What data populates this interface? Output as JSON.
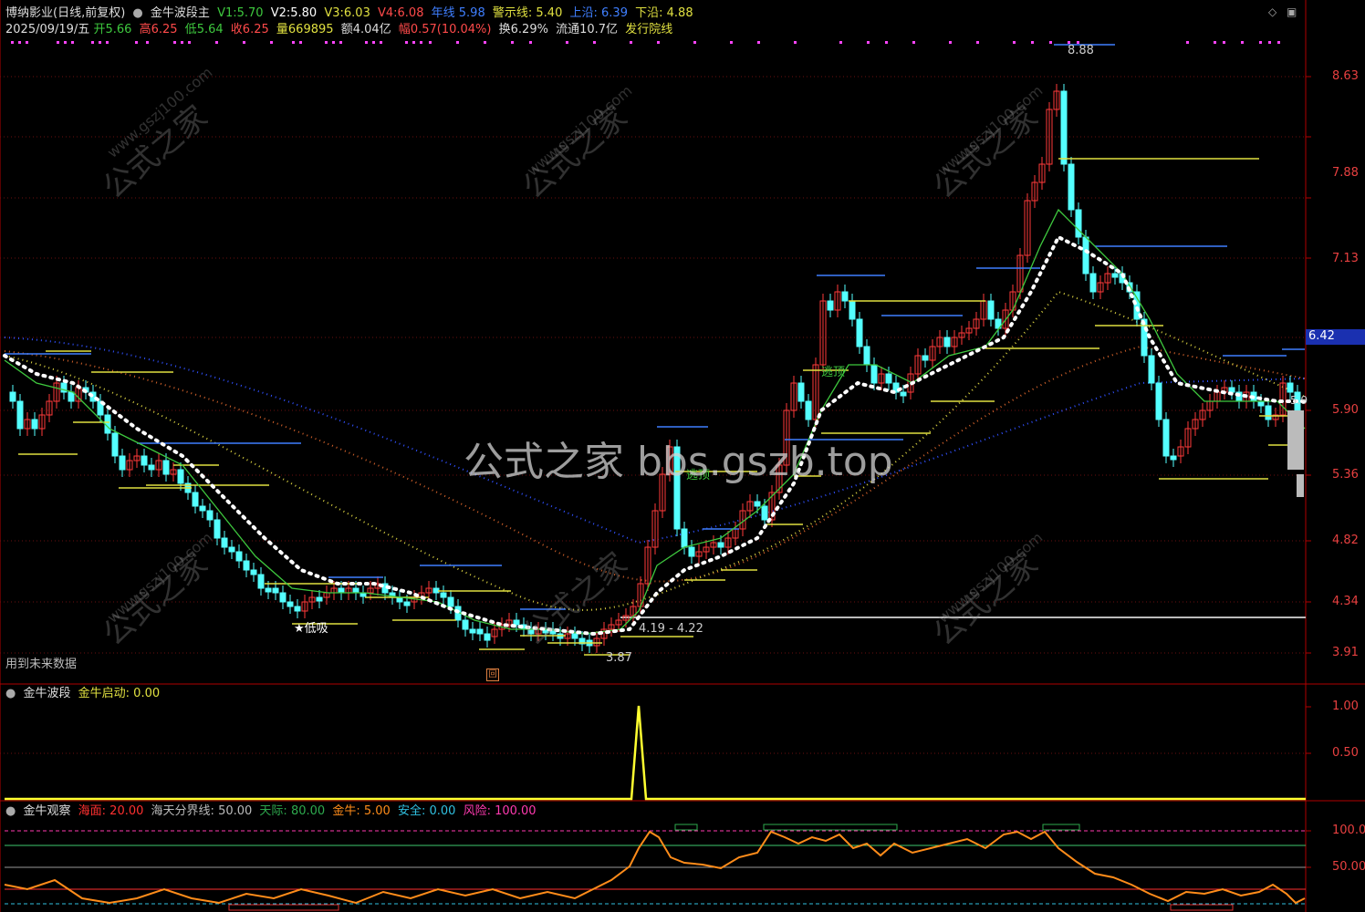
{
  "header": {
    "stock": "博纳影业(日线,前复权)",
    "indicator": "金牛波段主",
    "v1_label": "V1:",
    "v1": "5.70",
    "v2_label": "V2:",
    "v2": "5.80",
    "v3_label": "V3:",
    "v3": "6.03",
    "v4_label": "V4:",
    "v4": "6.08",
    "nianxian_label": "年线",
    "nianxian": "5.98",
    "jingshi_label": "警示线:",
    "jingshi": "5.40",
    "shangyan_label": "上沿:",
    "shangyan": "6.39",
    "xiayan_label": "下沿:",
    "xiayan": "4.88"
  },
  "quote": {
    "date": "2025/09/19/五",
    "open_label": "开",
    "open": "5.66",
    "high_label": "高",
    "high": "6.25",
    "low_label": "低",
    "low": "5.64",
    "close_label": "收",
    "close": "6.25",
    "vol_label": "量",
    "vol": "669895",
    "amt_label": "额",
    "amt": "4.04亿",
    "chg_label": "幅",
    "chg": "0.57(10.04%)",
    "turn_label": "换",
    "turn": "6.29%",
    "float_label": "流通",
    "float": "10.7亿",
    "issue": "发行院线"
  },
  "main_axis": [
    "8.63",
    "7.88",
    "7.13",
    "6.42",
    "5.90",
    "5.36",
    "4.82",
    "4.34",
    "3.91"
  ],
  "current_price_tag": "6.42",
  "annotations": {
    "peak": "8.88",
    "low": "3.87",
    "range": "4.19 - 4.22",
    "dixi": "★低吸",
    "taoding1": "逃顶",
    "taoding2": "逃顶",
    "right_small": "5.9",
    "future_note": "用到未来数据"
  },
  "watermark": {
    "center": "公式之家 bbs.gszb.top",
    "diag1": "公式之家",
    "diag2": "www.gszj100.com"
  },
  "panel2": {
    "title": "金牛波段",
    "item_label": "金牛启动:",
    "item_value": "0.00",
    "axis": [
      "1.00",
      "0.50"
    ]
  },
  "panel3": {
    "title": "金牛观察",
    "haimian_label": "海面:",
    "haimian": "20.00",
    "fenjie_label": "海天分界线:",
    "fenjie": "50.00",
    "tianji_label": "天际:",
    "tianji": "80.00",
    "jinniu_label": "金牛:",
    "jinniu": "5.00",
    "anquan_label": "安全:",
    "anquan": "0.00",
    "fengxian_label": "风险:",
    "fengxian": "100.00",
    "axis": [
      "100.0",
      "50.00"
    ]
  },
  "colors": {
    "up": "#ff3a3a",
    "down": "#54ffff",
    "axis": "#c00000",
    "ma_green": "#3ec83e",
    "white_dots": "#ffffff",
    "blue_line": "#3f7fff",
    "yellow_line": "#e0e040",
    "orange_curve": "#ff8c1a"
  }
}
